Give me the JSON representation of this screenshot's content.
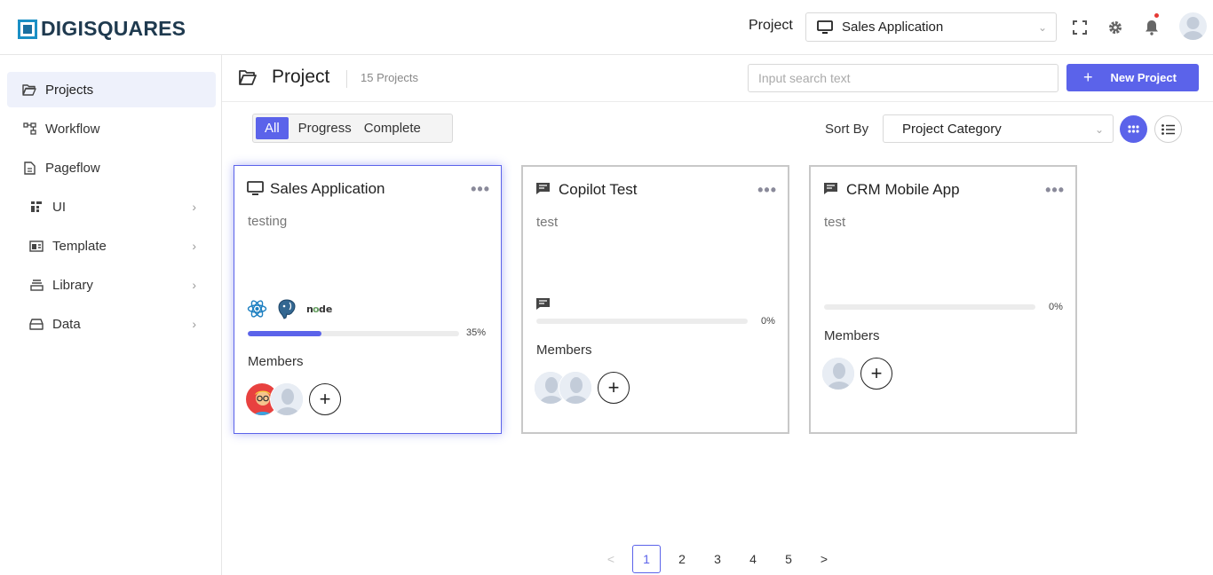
{
  "app": {
    "logo_text": "DIGISQUARES"
  },
  "topbar": {
    "project_label": "Project",
    "project_selected": "Sales Application",
    "icons": [
      "fullscreen-icon",
      "gear-icon",
      "bell-icon",
      "user-avatar"
    ]
  },
  "sidebar": {
    "items": [
      {
        "label": "Projects",
        "icon": "folder-open-icon",
        "active": true,
        "has_children": false
      },
      {
        "label": "Workflow",
        "icon": "workflow-icon",
        "active": false,
        "has_children": false
      },
      {
        "label": "Pageflow",
        "icon": "pageflow-icon",
        "active": false,
        "has_children": false
      },
      {
        "label": "UI",
        "icon": "ui-grid-icon",
        "active": false,
        "has_children": true
      },
      {
        "label": "Template",
        "icon": "template-icon",
        "active": false,
        "has_children": true
      },
      {
        "label": "Library",
        "icon": "library-icon",
        "active": false,
        "has_children": true
      },
      {
        "label": "Data",
        "icon": "database-icon",
        "active": false,
        "has_children": true
      }
    ]
  },
  "header": {
    "title": "Project",
    "count": "15 Projects",
    "search_placeholder": "Input search text",
    "new_button": "New Project"
  },
  "filters": {
    "tabs": [
      "All",
      "Progress",
      "Complete"
    ],
    "active": "All",
    "sort_label": "Sort By",
    "sort_value": "Project Category"
  },
  "cards": [
    {
      "title": "Sales Application",
      "icon": "monitor-icon",
      "description": "testing",
      "tech": [
        "react-icon",
        "postgresql-icon",
        "nodejs-icon"
      ],
      "progress": 35,
      "progress_text": "35%",
      "members_label": "Members",
      "selected": true
    },
    {
      "title": "Copilot Test",
      "icon": "chat-icon",
      "description": "test",
      "tech": [
        "chat-icon"
      ],
      "progress": 0,
      "progress_text": "0%",
      "members_label": "Members",
      "selected": false
    },
    {
      "title": "CRM Mobile App",
      "icon": "chat-icon",
      "description": "test",
      "tech": [],
      "progress": 0,
      "progress_text": "0%",
      "members_label": "Members",
      "selected": false
    }
  ],
  "pagination": {
    "prev": "<",
    "pages": [
      "1",
      "2",
      "3",
      "4",
      "5"
    ],
    "current": "1",
    "next": ">"
  },
  "colors": {
    "accent": "#5b63ea",
    "logo_blue": "#1a8fc5"
  }
}
